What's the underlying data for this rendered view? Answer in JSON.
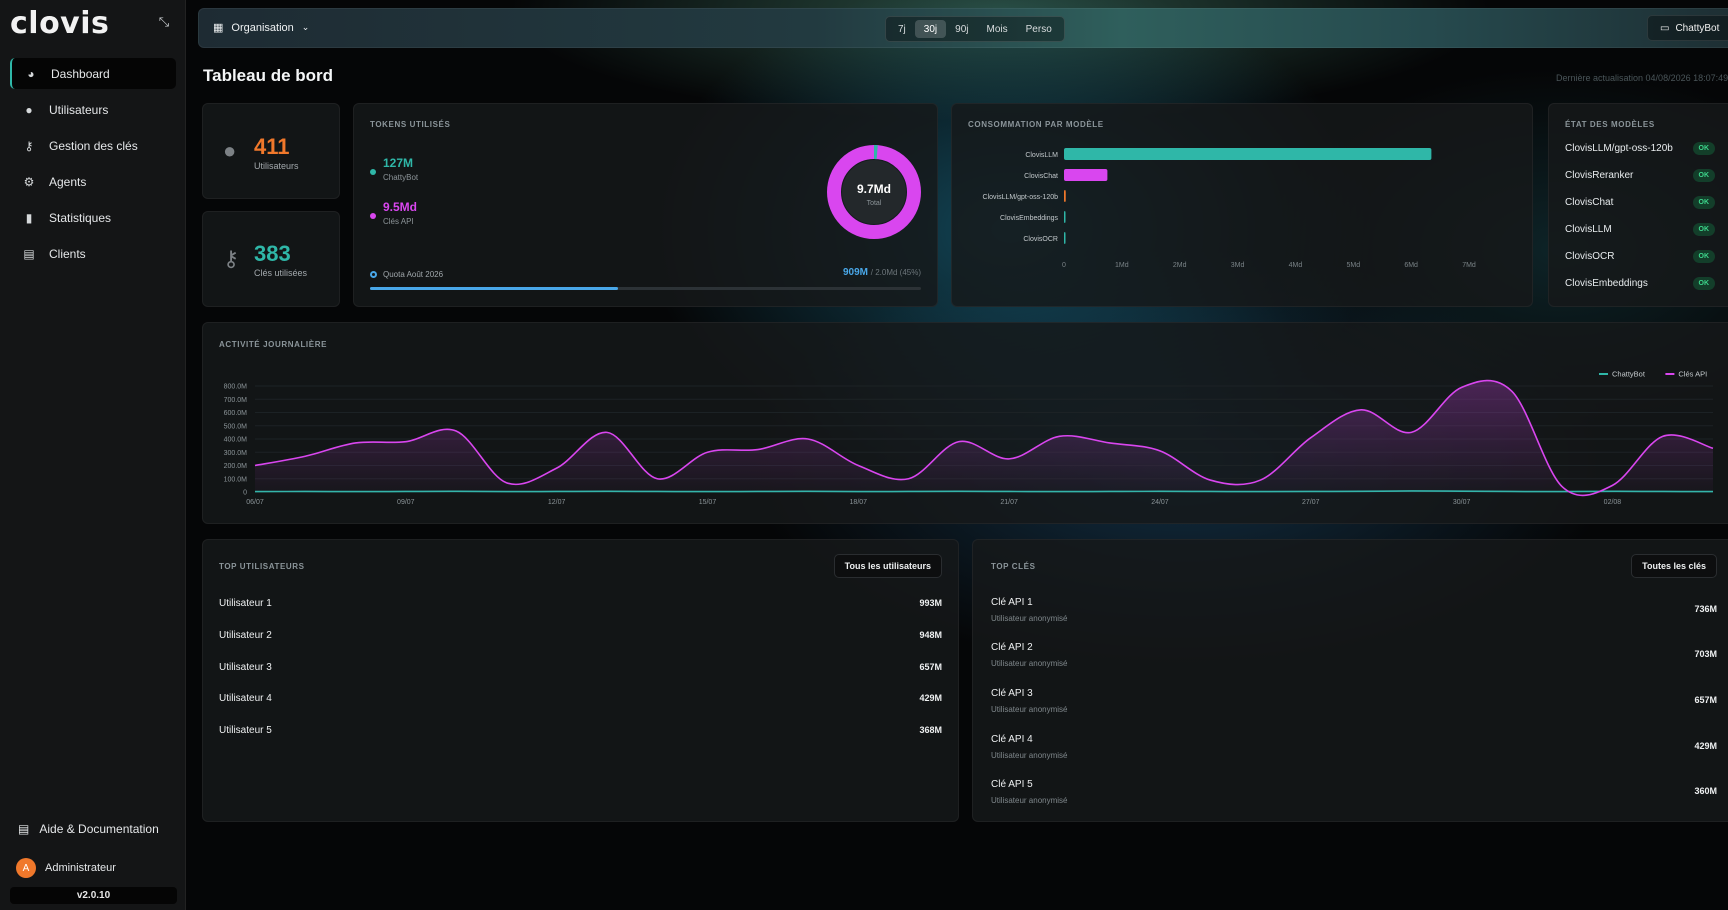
{
  "app": {
    "logo": "clovis",
    "version": "v2.0.10"
  },
  "sidebar": {
    "items": [
      {
        "label": "Dashboard",
        "icon": "dashboard-icon",
        "active": true
      },
      {
        "label": "Utilisateurs",
        "icon": "user-icon"
      },
      {
        "label": "Gestion des clés",
        "icon": "key-icon"
      },
      {
        "label": "Agents",
        "icon": "robot-icon"
      },
      {
        "label": "Statistiques",
        "icon": "bar-chart-icon"
      },
      {
        "label": "Clients",
        "icon": "document-icon"
      }
    ],
    "help": "Aide & Documentation",
    "user": {
      "initial": "A",
      "name": "Administrateur"
    }
  },
  "topbar": {
    "org": "Organisation",
    "periods": [
      {
        "label": "7j"
      },
      {
        "label": "30j",
        "active": true
      },
      {
        "label": "90j"
      },
      {
        "label": "Mois"
      },
      {
        "label": "Perso"
      }
    ],
    "chattybot": "ChattyBot"
  },
  "page": {
    "title": "Tableau de bord",
    "last_update": "Dernière actualisation 04/08/2026 18:07:49"
  },
  "stats": {
    "users": {
      "value": "411",
      "label": "Utilisateurs"
    },
    "keys": {
      "value": "383",
      "label": "Clés utilisées"
    }
  },
  "tokens": {
    "title": "TOKENS UTILISÉS",
    "chattybot": {
      "value": "127M",
      "label": "ChattyBot"
    },
    "api": {
      "value": "9.5Md",
      "label": "Clés API"
    },
    "total": {
      "value": "9.7Md",
      "label": "Total"
    },
    "quota": {
      "label": "Quota Août 2026",
      "value": "909M",
      "limit": "/ 2.0Md (45%)",
      "fraction": 0.45
    },
    "donut_fraction_chattybot": 0.013
  },
  "consumption": {
    "title": "CONSOMMATION PAR MODÈLE"
  },
  "model_status": {
    "title": "ÉTAT DES MODÈLES",
    "models": [
      {
        "name": "ClovisLLM/gpt-oss-120b",
        "status": "OK"
      },
      {
        "name": "ClovisReranker",
        "status": "OK"
      },
      {
        "name": "ClovisChat",
        "status": "OK"
      },
      {
        "name": "ClovisLLM",
        "status": "OK"
      },
      {
        "name": "ClovisOCR",
        "status": "OK"
      },
      {
        "name": "ClovisEmbeddings",
        "status": "OK"
      }
    ]
  },
  "activity": {
    "title": "ACTIVITÉ JOURNALIÈRE"
  },
  "top_users": {
    "title": "TOP UTILISATEURS",
    "button": "Tous les utilisateurs",
    "rows": [
      {
        "name": "Utilisateur 1",
        "value": "993M"
      },
      {
        "name": "Utilisateur 2",
        "value": "948M"
      },
      {
        "name": "Utilisateur 3",
        "value": "657M"
      },
      {
        "name": "Utilisateur 4",
        "value": "429M"
      },
      {
        "name": "Utilisateur 5",
        "value": "368M"
      }
    ]
  },
  "top_keys": {
    "title": "TOP CLÉS",
    "button": "Toutes les clés",
    "rows": [
      {
        "name": "Clé API 1",
        "sub": "Utilisateur anonymisé",
        "value": "736M"
      },
      {
        "name": "Clé API 2",
        "sub": "Utilisateur anonymisé",
        "value": "703M"
      },
      {
        "name": "Clé API 3",
        "sub": "Utilisateur anonymisé",
        "value": "657M"
      },
      {
        "name": "Clé API 4",
        "sub": "Utilisateur anonymisé",
        "value": "429M"
      },
      {
        "name": "Clé API 5",
        "sub": "Utilisateur anonymisé",
        "value": "360M"
      }
    ]
  },
  "colors": {
    "teal": "#2fb7a8",
    "magenta": "#d946ef",
    "orange": "#f0782b",
    "blue": "#49a7e8",
    "ok": "#3dd68c"
  },
  "chart_data": [
    {
      "type": "bar",
      "orientation": "horizontal",
      "categories": [
        "ClovisLLM",
        "ClovisChat",
        "ClovisLLM/gpt-oss-120b",
        "ClovisEmbeddings",
        "ClovisOCR"
      ],
      "values": [
        6.35,
        0.75,
        0.03,
        0.005,
        0.003
      ],
      "colors": [
        "#2fb7a8",
        "#d946ef",
        "#f0782b",
        "#2fb7a8",
        "#2fb7a8"
      ],
      "xticks": [
        "0",
        "1Md",
        "2Md",
        "3Md",
        "4Md",
        "5Md",
        "6Md",
        "7Md"
      ],
      "xlim": [
        0,
        7
      ]
    },
    {
      "type": "area",
      "x": [
        "06/07",
        "07/07",
        "08/07",
        "09/07",
        "10/07",
        "11/07",
        "12/07",
        "13/07",
        "14/07",
        "15/07",
        "16/07",
        "17/07",
        "18/07",
        "19/07",
        "20/07",
        "21/07",
        "22/07",
        "23/07",
        "24/07",
        "25/07",
        "26/07",
        "27/07",
        "28/07",
        "29/07",
        "30/07",
        "31/07",
        "01/08",
        "02/08",
        "03/08",
        "04/08"
      ],
      "xticks": [
        "06/07",
        "09/07",
        "12/07",
        "15/07",
        "18/07",
        "21/07",
        "24/07",
        "27/07",
        "30/07",
        "02/08"
      ],
      "yticks": [
        "0",
        "100.0M",
        "200.0M",
        "300.0M",
        "400.0M",
        "500.0M",
        "600.0M",
        "700.0M",
        "800.0M"
      ],
      "ylim": [
        0,
        800
      ],
      "series": [
        {
          "name": "ChattyBot",
          "color": "#2fb7a8",
          "values": [
            3,
            4,
            3,
            4,
            5,
            3,
            4,
            5,
            4,
            3,
            4,
            5,
            3,
            4,
            5,
            4,
            3,
            4,
            5,
            4,
            3,
            4,
            5,
            8,
            6,
            4,
            3,
            5,
            4,
            3
          ]
        },
        {
          "name": "Clés API",
          "color": "#d946ef",
          "values": [
            200,
            270,
            370,
            380,
            460,
            70,
            180,
            450,
            100,
            300,
            320,
            400,
            200,
            100,
            380,
            250,
            420,
            370,
            310,
            90,
            90,
            410,
            620,
            450,
            790,
            760,
            40,
            50,
            420,
            330
          ]
        }
      ],
      "legend": "top-right"
    }
  ]
}
